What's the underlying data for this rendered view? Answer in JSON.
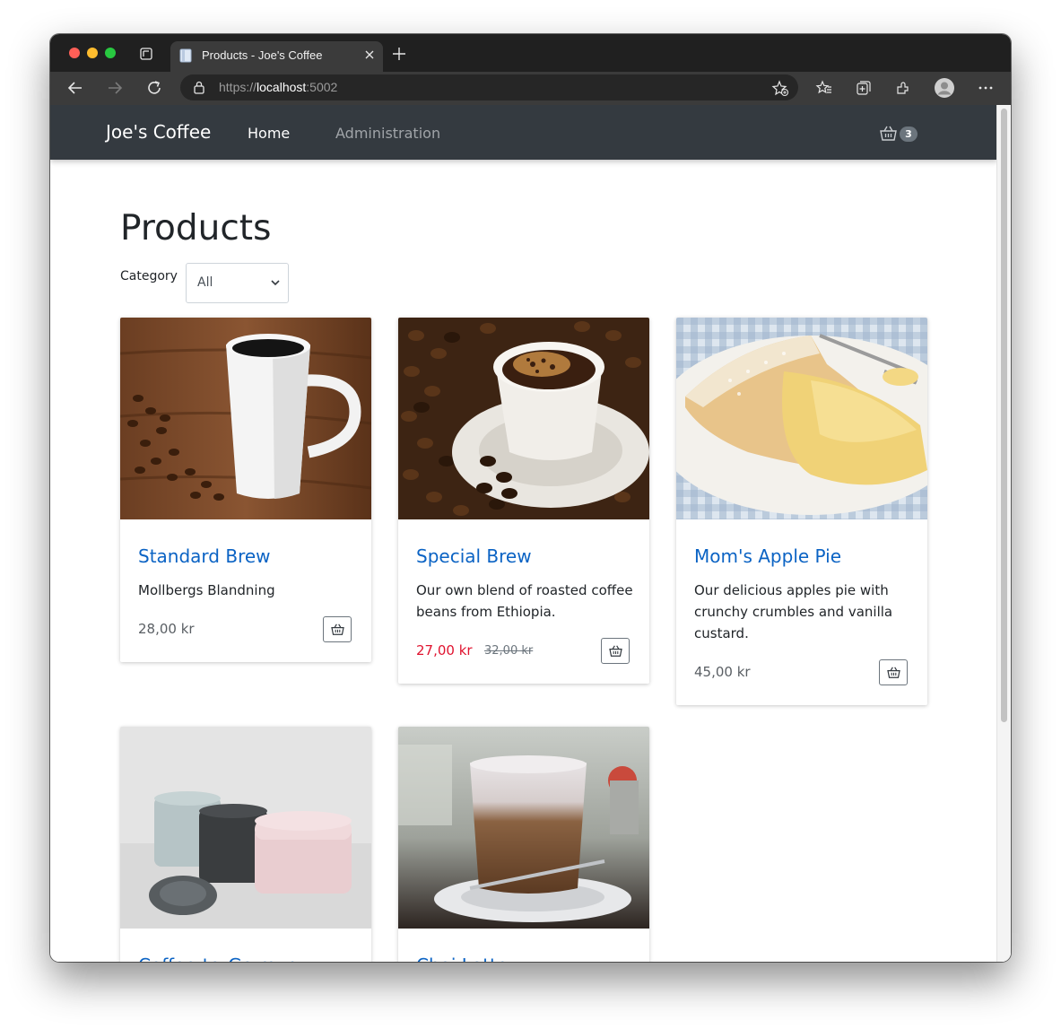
{
  "browser": {
    "tab_title": "Products - Joe's Coffee",
    "url_scheme": "https://",
    "url_host": "localhost",
    "url_port": ":5002"
  },
  "nav": {
    "brand": "Joe's Coffee",
    "home": "Home",
    "administration": "Administration",
    "cart_count": "3"
  },
  "page": {
    "title": "Products",
    "category_label": "Category",
    "category_value": "All"
  },
  "products": [
    {
      "name": "Standard Brew",
      "description": "Mollbergs Blandning",
      "price": "28,00 kr",
      "image": "coffee-mug-photo"
    },
    {
      "name": "Special Brew",
      "description": "Our own blend of roasted coffee beans from Ethiopia.",
      "price": "27,00 kr",
      "old_price": "32,00 kr",
      "image": "coffee-cup-beans-photo"
    },
    {
      "name": "Mom's Apple Pie",
      "description": "Our delicious apples pie with crunchy crumbles and vanilla custard.",
      "price": "45,00 kr",
      "image": "apple-pie-photo"
    },
    {
      "name": "Coffee-to-Go mug",
      "image": "to-go-mugs-photo"
    },
    {
      "name": "Chai Latte",
      "image": "chai-latte-photo"
    }
  ],
  "colors": {
    "navbar": "#343a40",
    "link": "#0b63c4",
    "sale_price": "#e0132f"
  }
}
